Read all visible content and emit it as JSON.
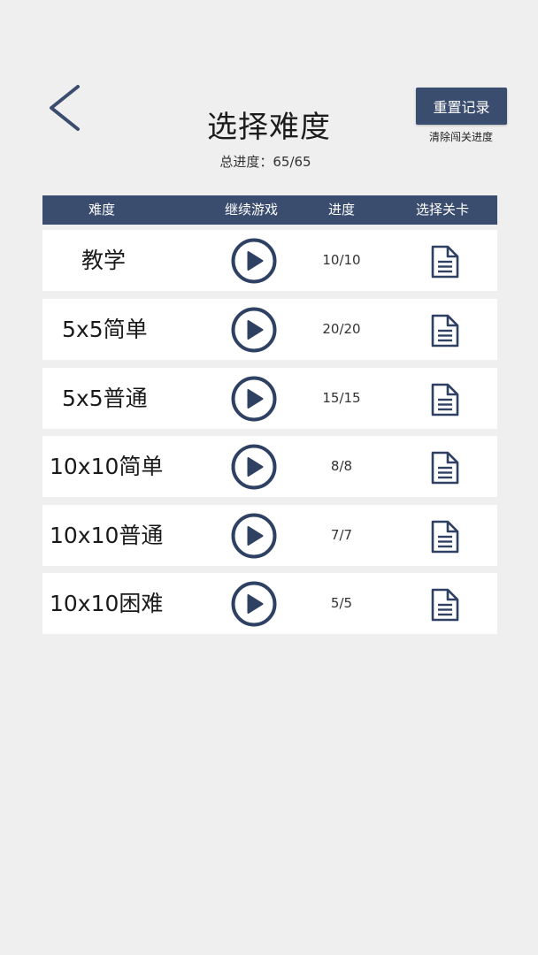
{
  "header": {
    "title": "选择难度",
    "total_progress": "总进度：65/65",
    "reset_label": "重置记录",
    "reset_hint": "清除闯关进度"
  },
  "table": {
    "columns": [
      "难度",
      "继续游戏",
      "进度",
      "选择关卡"
    ],
    "rows": [
      {
        "name": "教学",
        "progress": "10/10"
      },
      {
        "name": "5x5简单",
        "progress": "20/20"
      },
      {
        "name": "5x5普通",
        "progress": "15/15"
      },
      {
        "name": "10x10简单",
        "progress": "8/8"
      },
      {
        "name": "10x10普通",
        "progress": "7/7"
      },
      {
        "name": "10x10困难",
        "progress": "5/5"
      }
    ]
  },
  "icons": {
    "back": "chevron-left-icon",
    "play": "play-circle-icon",
    "level": "document-icon"
  },
  "colors": {
    "accent": "#3b4d6f",
    "background": "#efefef",
    "row": "#ffffff"
  }
}
